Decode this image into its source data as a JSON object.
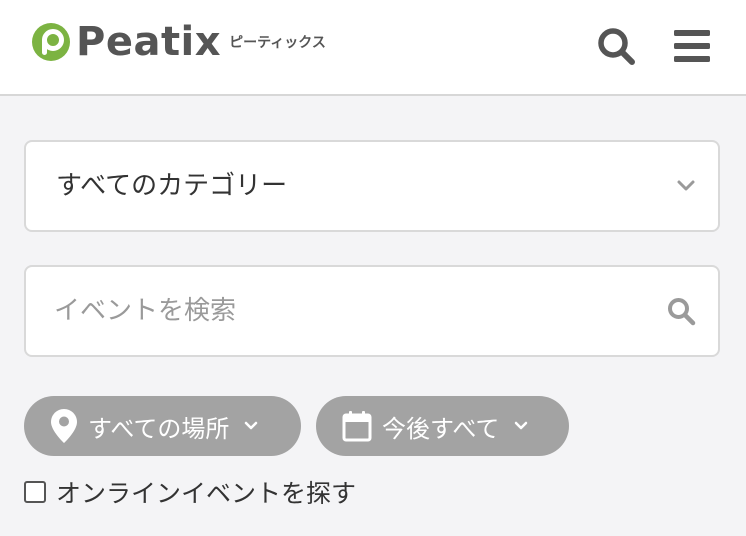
{
  "header": {
    "logo_text": "Peatix",
    "logo_kana": "ピーティックス",
    "logo_color": "#7cb342",
    "icons": [
      "search-icon",
      "menu-icon"
    ]
  },
  "category": {
    "selected": "すべてのカテゴリー",
    "icon": "chevron-down-icon"
  },
  "search": {
    "placeholder": "イベントを検索",
    "value": "",
    "icon": "search-icon"
  },
  "filters": {
    "location_label": "すべての場所",
    "location_icon": "map-pin-icon",
    "date_label": "今後すべて",
    "date_icon": "calendar-icon",
    "pill_color": "#a3a3a3"
  },
  "online": {
    "label": "オンラインイベントを探す",
    "checked": false
  }
}
